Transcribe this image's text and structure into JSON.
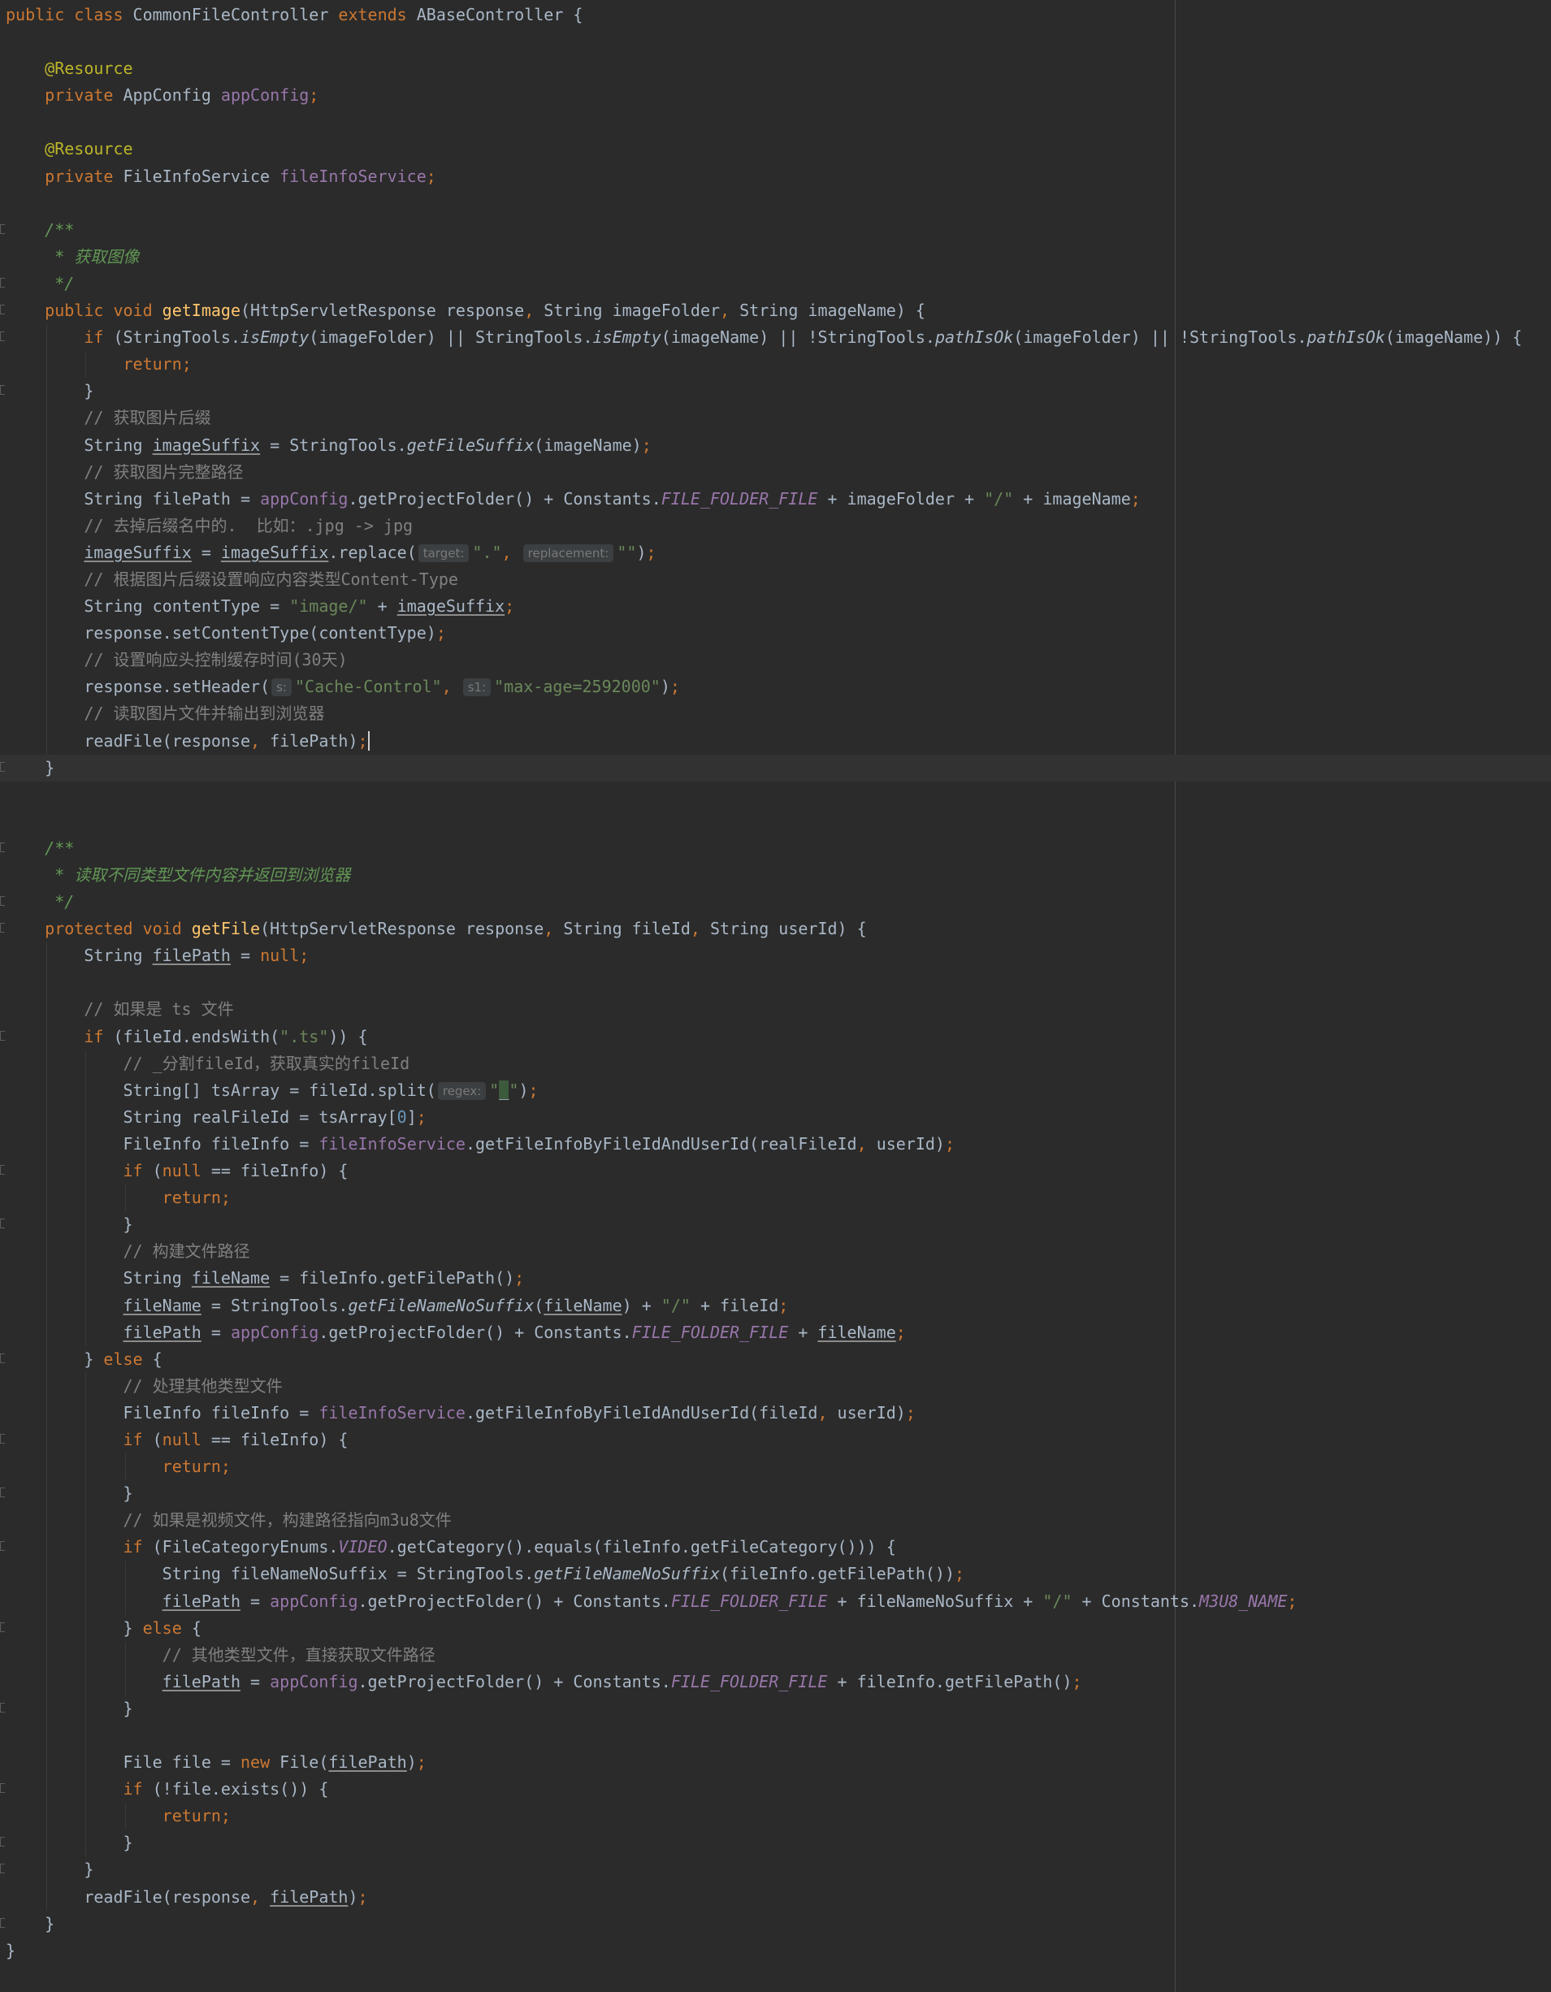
{
  "editor": {
    "language": "java",
    "current_line": 28,
    "lines": [
      {
        "i": 0,
        "t": [
          [
            "kw",
            "public class "
          ],
          [
            "",
            "CommonFileController "
          ],
          [
            "kw",
            "extends "
          ],
          [
            "",
            "ABaseController {"
          ]
        ]
      },
      {
        "i": 0,
        "t": []
      },
      {
        "i": 1,
        "t": [
          [
            "ann",
            "@Resource"
          ]
        ]
      },
      {
        "i": 1,
        "t": [
          [
            "kw",
            "private "
          ],
          [
            "",
            "AppConfig "
          ],
          [
            "fld",
            "appConfig"
          ],
          [
            "kw",
            ";"
          ]
        ]
      },
      {
        "i": 1,
        "t": []
      },
      {
        "i": 1,
        "t": [
          [
            "ann",
            "@Resource"
          ]
        ]
      },
      {
        "i": 1,
        "t": [
          [
            "kw",
            "private "
          ],
          [
            "",
            "FileInfoService "
          ],
          [
            "fld",
            "fileInfoService"
          ],
          [
            "kw",
            ";"
          ]
        ]
      },
      {
        "i": 1,
        "t": []
      },
      {
        "i": 1,
        "f": true,
        "t": [
          [
            "doc",
            "/**"
          ]
        ]
      },
      {
        "i": 1,
        "t": [
          [
            "doc",
            " * 获取图像"
          ]
        ]
      },
      {
        "i": 1,
        "f": true,
        "t": [
          [
            "doc",
            " */"
          ]
        ]
      },
      {
        "i": 1,
        "f": true,
        "t": [
          [
            "kw",
            "public void "
          ],
          [
            "fn",
            "getImage"
          ],
          [
            "",
            "(HttpServletResponse response"
          ],
          [
            "kw",
            ", "
          ],
          [
            "",
            "String imageFolder"
          ],
          [
            "kw",
            ", "
          ],
          [
            "",
            "String imageName) {"
          ]
        ]
      },
      {
        "i": 2,
        "f": true,
        "t": [
          [
            "kw",
            "if "
          ],
          [
            "",
            "(StringTools."
          ],
          [
            "st",
            "isEmpty"
          ],
          [
            "",
            "(imageFolder) || StringTools."
          ],
          [
            "st",
            "isEmpty"
          ],
          [
            "",
            "(imageName) || !StringTools."
          ],
          [
            "st",
            "pathIsOk"
          ],
          [
            "",
            "(imageFolder) || !StringTools."
          ],
          [
            "st",
            "pathIsOk"
          ],
          [
            "",
            "(imageName)) {"
          ]
        ]
      },
      {
        "i": 3,
        "t": [
          [
            "kw",
            "return;"
          ]
        ]
      },
      {
        "i": 2,
        "f": true,
        "t": [
          [
            "",
            "}"
          ]
        ]
      },
      {
        "i": 2,
        "t": [
          [
            "cm",
            "// 获取图片后缀"
          ]
        ]
      },
      {
        "i": 2,
        "t": [
          [
            "",
            "String "
          ],
          [
            "ul",
            "imageSuffix"
          ],
          [
            "",
            " = StringTools."
          ],
          [
            "st",
            "getFileSuffix"
          ],
          [
            "",
            "(imageName)"
          ],
          [
            "kw",
            ";"
          ]
        ]
      },
      {
        "i": 2,
        "t": [
          [
            "cm",
            "// 获取图片完整路径"
          ]
        ]
      },
      {
        "i": 2,
        "t": [
          [
            "",
            "String filePath = "
          ],
          [
            "fld",
            "appConfig"
          ],
          [
            "",
            ".getProjectFolder() + Constants."
          ],
          [
            "cst",
            "FILE_FOLDER_FILE"
          ],
          [
            "",
            " + imageFolder + "
          ],
          [
            "str",
            "\"/\""
          ],
          [
            "",
            " + imageName"
          ],
          [
            "kw",
            ";"
          ]
        ]
      },
      {
        "i": 2,
        "t": [
          [
            "cm",
            "// 去掉后缀名中的.  比如：.jpg -> jpg"
          ]
        ]
      },
      {
        "i": 2,
        "t": [
          [
            "ul",
            "imageSuffix"
          ],
          [
            "",
            " = "
          ],
          [
            "ul",
            "imageSuffix"
          ],
          [
            "",
            ".replace("
          ],
          [
            "hint",
            "target:"
          ],
          [
            "str",
            "\".\""
          ],
          [
            "kw",
            ", "
          ],
          [
            "hint",
            "replacement:"
          ],
          [
            "str",
            "\"\""
          ],
          [
            "",
            ")"
          ],
          [
            "kw",
            ";"
          ]
        ]
      },
      {
        "i": 2,
        "t": [
          [
            "cm",
            "// 根据图片后缀设置响应内容类型Content-Type"
          ]
        ]
      },
      {
        "i": 2,
        "t": [
          [
            "",
            "String contentType = "
          ],
          [
            "str",
            "\"image/\""
          ],
          [
            "",
            " + "
          ],
          [
            "ul",
            "imageSuffix"
          ],
          [
            "kw",
            ";"
          ]
        ]
      },
      {
        "i": 2,
        "t": [
          [
            "",
            "response.setContentType(contentType)"
          ],
          [
            "kw",
            ";"
          ]
        ]
      },
      {
        "i": 2,
        "t": [
          [
            "cm",
            "// 设置响应头控制缓存时间(30天)"
          ]
        ]
      },
      {
        "i": 2,
        "t": [
          [
            "",
            "response.setHeader("
          ],
          [
            "hint",
            "s:"
          ],
          [
            "str",
            "\"Cache-Control\""
          ],
          [
            "kw",
            ", "
          ],
          [
            "hint",
            "s1:"
          ],
          [
            "str",
            "\"max-age=2592000\""
          ],
          [
            "",
            ")"
          ],
          [
            "kw",
            ";"
          ]
        ]
      },
      {
        "i": 2,
        "t": [
          [
            "cm",
            "// 读取图片文件并输出到浏览器"
          ]
        ]
      },
      {
        "i": 2,
        "t": [
          [
            "",
            "readFile(response"
          ],
          [
            "kw",
            ", "
          ],
          [
            "",
            "filePath)"
          ],
          [
            "kw",
            ";"
          ],
          [
            "caret",
            ""
          ]
        ]
      },
      {
        "i": 1,
        "f": true,
        "t": [
          [
            "",
            "}"
          ]
        ]
      },
      {
        "i": 0,
        "t": []
      },
      {
        "i": 0,
        "t": []
      },
      {
        "i": 1,
        "f": true,
        "t": [
          [
            "doc",
            "/**"
          ]
        ]
      },
      {
        "i": 1,
        "t": [
          [
            "doc",
            " * 读取不同类型文件内容并返回到浏览器"
          ]
        ]
      },
      {
        "i": 1,
        "f": true,
        "t": [
          [
            "doc",
            " */"
          ]
        ]
      },
      {
        "i": 1,
        "f": true,
        "t": [
          [
            "kw",
            "protected void "
          ],
          [
            "fn",
            "getFile"
          ],
          [
            "",
            "(HttpServletResponse response"
          ],
          [
            "kw",
            ", "
          ],
          [
            "",
            "String fileId"
          ],
          [
            "kw",
            ", "
          ],
          [
            "",
            "String userId) {"
          ]
        ]
      },
      {
        "i": 2,
        "t": [
          [
            "",
            "String "
          ],
          [
            "ul",
            "filePath"
          ],
          [
            "",
            " = "
          ],
          [
            "kw",
            "null;"
          ]
        ]
      },
      {
        "i": 2,
        "t": []
      },
      {
        "i": 2,
        "t": [
          [
            "cm",
            "// 如果是 ts 文件"
          ]
        ]
      },
      {
        "i": 2,
        "f": true,
        "t": [
          [
            "kw",
            "if "
          ],
          [
            "",
            "(fileId.endsWith("
          ],
          [
            "str",
            "\".ts\""
          ],
          [
            "",
            ")) {"
          ]
        ]
      },
      {
        "i": 3,
        "t": [
          [
            "cm",
            "// _分割fileId，获取真实的fileId"
          ]
        ]
      },
      {
        "i": 3,
        "t": [
          [
            "",
            "String[] tsArray = fileId.split("
          ],
          [
            "hint",
            "regex:"
          ],
          [
            "str",
            "\""
          ],
          [
            "mark",
            "_"
          ],
          [
            "str",
            "\""
          ],
          [
            "",
            ")"
          ],
          [
            "kw",
            ";"
          ]
        ]
      },
      {
        "i": 3,
        "t": [
          [
            "",
            "String realFileId = tsArray["
          ],
          [
            "num",
            "0"
          ],
          [
            "",
            "]"
          ],
          [
            "kw",
            ";"
          ]
        ]
      },
      {
        "i": 3,
        "t": [
          [
            "",
            "FileInfo fileInfo = "
          ],
          [
            "fld",
            "fileInfoService"
          ],
          [
            "",
            ".getFileInfoByFileIdAndUserId(realFileId"
          ],
          [
            "kw",
            ", "
          ],
          [
            "",
            "userId)"
          ],
          [
            "kw",
            ";"
          ]
        ]
      },
      {
        "i": 3,
        "f": true,
        "t": [
          [
            "kw",
            "if "
          ],
          [
            "",
            "("
          ],
          [
            "kw",
            "null "
          ],
          [
            "",
            "== fileInfo) {"
          ]
        ]
      },
      {
        "i": 4,
        "t": [
          [
            "kw",
            "return;"
          ]
        ]
      },
      {
        "i": 3,
        "f": true,
        "t": [
          [
            "",
            "}"
          ]
        ]
      },
      {
        "i": 3,
        "t": [
          [
            "cm",
            "// 构建文件路径"
          ]
        ]
      },
      {
        "i": 3,
        "t": [
          [
            "",
            "String "
          ],
          [
            "ul",
            "fileName"
          ],
          [
            "",
            " = fileInfo.getFilePath()"
          ],
          [
            "kw",
            ";"
          ]
        ]
      },
      {
        "i": 3,
        "t": [
          [
            "ul",
            "fileName"
          ],
          [
            "",
            " = StringTools."
          ],
          [
            "st",
            "getFileNameNoSuffix"
          ],
          [
            "",
            "("
          ],
          [
            "ul",
            "fileName"
          ],
          [
            "",
            ") + "
          ],
          [
            "str",
            "\"/\""
          ],
          [
            "",
            " + fileId"
          ],
          [
            "kw",
            ";"
          ]
        ]
      },
      {
        "i": 3,
        "t": [
          [
            "ul",
            "filePath"
          ],
          [
            "",
            " = "
          ],
          [
            "fld",
            "appConfig"
          ],
          [
            "",
            ".getProjectFolder() + Constants."
          ],
          [
            "cst",
            "FILE_FOLDER_FILE"
          ],
          [
            "",
            " + "
          ],
          [
            "ul",
            "fileName"
          ],
          [
            "kw",
            ";"
          ]
        ]
      },
      {
        "i": 2,
        "f": true,
        "t": [
          [
            "",
            "} "
          ],
          [
            "kw",
            "else "
          ],
          [
            "",
            "{"
          ]
        ]
      },
      {
        "i": 3,
        "t": [
          [
            "cm",
            "// 处理其他类型文件"
          ]
        ]
      },
      {
        "i": 3,
        "t": [
          [
            "",
            "FileInfo fileInfo = "
          ],
          [
            "fld",
            "fileInfoService"
          ],
          [
            "",
            ".getFileInfoByFileIdAndUserId(fileId"
          ],
          [
            "kw",
            ", "
          ],
          [
            "",
            "userId)"
          ],
          [
            "kw",
            ";"
          ]
        ]
      },
      {
        "i": 3,
        "f": true,
        "t": [
          [
            "kw",
            "if "
          ],
          [
            "",
            "("
          ],
          [
            "kw",
            "null "
          ],
          [
            "",
            "== fileInfo) {"
          ]
        ]
      },
      {
        "i": 4,
        "t": [
          [
            "kw",
            "return;"
          ]
        ]
      },
      {
        "i": 3,
        "f": true,
        "t": [
          [
            "",
            "}"
          ]
        ]
      },
      {
        "i": 3,
        "t": [
          [
            "cm",
            "// 如果是视频文件，构建路径指向m3u8文件"
          ]
        ]
      },
      {
        "i": 3,
        "f": true,
        "t": [
          [
            "kw",
            "if "
          ],
          [
            "",
            "(FileCategoryEnums."
          ],
          [
            "cst",
            "VIDEO"
          ],
          [
            "",
            ".getCategory().equals(fileInfo.getFileCategory())) {"
          ]
        ]
      },
      {
        "i": 4,
        "t": [
          [
            "",
            "String fileNameNoSuffix = StringTools."
          ],
          [
            "st",
            "getFileNameNoSuffix"
          ],
          [
            "",
            "(fileInfo.getFilePath())"
          ],
          [
            "kw",
            ";"
          ]
        ]
      },
      {
        "i": 4,
        "t": [
          [
            "ul",
            "filePath"
          ],
          [
            "",
            " = "
          ],
          [
            "fld",
            "appConfig"
          ],
          [
            "",
            ".getProjectFolder() + Constants."
          ],
          [
            "cst",
            "FILE_FOLDER_FILE"
          ],
          [
            "",
            " + fileNameNoSuffix + "
          ],
          [
            "str",
            "\"/\""
          ],
          [
            "",
            " + Constants."
          ],
          [
            "cst",
            "M3U8_NAME"
          ],
          [
            "kw",
            ";"
          ]
        ]
      },
      {
        "i": 3,
        "f": true,
        "t": [
          [
            "",
            "} "
          ],
          [
            "kw",
            "else "
          ],
          [
            "",
            "{"
          ]
        ]
      },
      {
        "i": 4,
        "t": [
          [
            "cm",
            "// 其他类型文件，直接获取文件路径"
          ]
        ]
      },
      {
        "i": 4,
        "t": [
          [
            "ul",
            "filePath"
          ],
          [
            "",
            " = "
          ],
          [
            "fld",
            "appConfig"
          ],
          [
            "",
            ".getProjectFolder() + Constants."
          ],
          [
            "cst",
            "FILE_FOLDER_FILE"
          ],
          [
            "",
            " + fileInfo.getFilePath()"
          ],
          [
            "kw",
            ";"
          ]
        ]
      },
      {
        "i": 3,
        "f": true,
        "t": [
          [
            "",
            "}"
          ]
        ]
      },
      {
        "i": 3,
        "t": []
      },
      {
        "i": 3,
        "t": [
          [
            "",
            "File file = "
          ],
          [
            "kw",
            "new "
          ],
          [
            "",
            "File("
          ],
          [
            "ul",
            "filePath"
          ],
          [
            "",
            ")"
          ],
          [
            "kw",
            ";"
          ]
        ]
      },
      {
        "i": 3,
        "f": true,
        "t": [
          [
            "kw",
            "if "
          ],
          [
            "",
            "(!file.exists()) {"
          ]
        ]
      },
      {
        "i": 4,
        "t": [
          [
            "kw",
            "return;"
          ]
        ]
      },
      {
        "i": 3,
        "f": true,
        "t": [
          [
            "",
            "}"
          ]
        ]
      },
      {
        "i": 2,
        "f": true,
        "t": [
          [
            "",
            "}"
          ]
        ]
      },
      {
        "i": 2,
        "t": [
          [
            "",
            "readFile(response"
          ],
          [
            "kw",
            ", "
          ],
          [
            "ul",
            "filePath"
          ],
          [
            "",
            ")"
          ],
          [
            "kw",
            ";"
          ]
        ]
      },
      {
        "i": 1,
        "f": true,
        "t": [
          [
            "",
            "}"
          ]
        ]
      },
      {
        "i": 0,
        "t": [
          [
            "",
            "}"
          ]
        ]
      }
    ]
  }
}
